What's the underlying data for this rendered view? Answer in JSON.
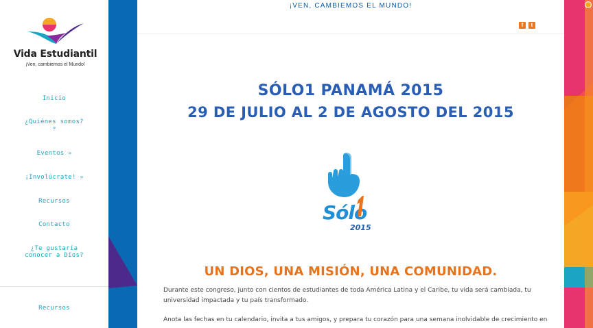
{
  "brand": {
    "name": "Vida Estudiantil",
    "tagline": "¡Ven, cambiemos el Mundo!"
  },
  "nav": {
    "inicio": "Inicio",
    "quienes": "¿Quiénes somos?",
    "eventos": "Eventos",
    "involucrate": "¡Involúcrate!",
    "recursos": "Recursos",
    "contacto": "Contacto",
    "conocer_line1": "¿Te gustaría",
    "conocer_line2": "conocer a Dios?",
    "footer_recursos": "Recursos",
    "chevron": "»"
  },
  "header": {
    "banner": "¡VEN, CAMBIEMOS EL MUNDO!",
    "social": [
      {
        "icon": "facebook-icon",
        "glyph": "f"
      },
      {
        "icon": "twitter-icon",
        "glyph": "t"
      }
    ]
  },
  "main": {
    "title": "SÓLO1 PANAMÁ 2015",
    "dates": "29 DE JULIO AL 2 DE AGOSTO DEL 2015",
    "event_logo": {
      "word": "Sólo",
      "year": "2015"
    },
    "mission": "UN DIOS, UNA MISIÓN, UNA COMUNIDAD.",
    "paragraph1": "Durante este congreso, junto con cientos de estudiantes de toda América Latina y el Caribe, tu vida será cambiada, tu universidad impactada y tu país transformado.",
    "paragraph2": "Anota las fechas en tu calendario, invita a tus amigos, y prepara tu corazón para una semana inolvidable de crecimiento en tu relación"
  },
  "colors": {
    "accent_blue": "#0a69b3",
    "nav_teal": "#1aa6c2",
    "title_blue": "#2a5db4",
    "orange": "#e8731d",
    "purple": "#4b2a8c"
  }
}
